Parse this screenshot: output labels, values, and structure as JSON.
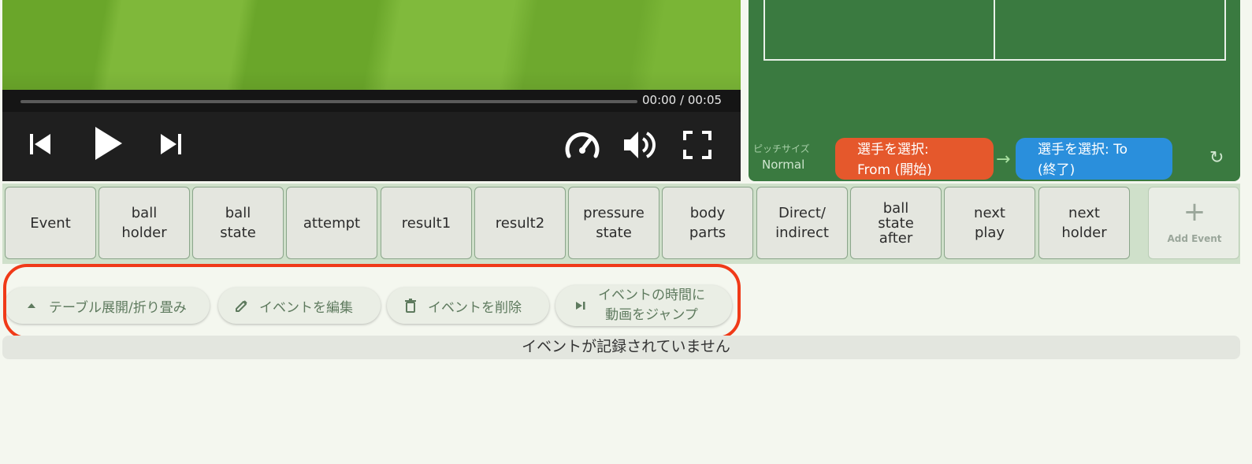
{
  "video": {
    "time": "00:00 / 00:05",
    "progress_fraction": 0.0
  },
  "pitch": {
    "size_label": "ピッチサイズ",
    "size_value": "Normal",
    "from_label": "選手を選択:\nFrom (開始)",
    "to_label": "選手を選択: To\n(終了)",
    "colors": {
      "from": "#e5582c",
      "to": "#2a8fdc",
      "field": "#3a7a40"
    }
  },
  "events": {
    "buttons": [
      "Event",
      "ball\nholder",
      "ball\nstate",
      "attempt",
      "result1",
      "result2",
      "pressure\nstate",
      "body\nparts",
      "Direct/\nindirect",
      "ball\nstate\nafter",
      "next\nplay",
      "next\nholder"
    ],
    "add_label": "Add Event"
  },
  "actions": {
    "toggle_table": "テーブル展開/折り畳み",
    "edit_event": "イベントを編集",
    "delete_event": "イベントを削除",
    "jump_video": "イベントの時間に\n動画をジャンプ"
  },
  "empty_message": "イベントが記録されていません"
}
